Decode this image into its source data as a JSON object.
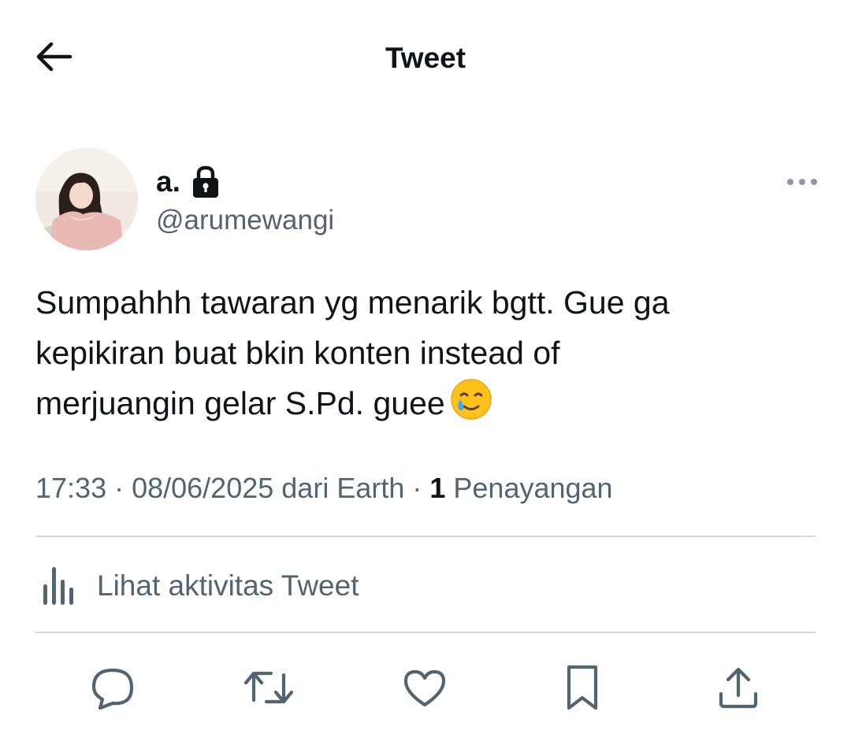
{
  "header": {
    "back_icon": "arrow-left-icon",
    "title": "Tweet"
  },
  "author": {
    "display_name": "a.",
    "handle": "@arumewangi",
    "protected_icon": "lock-icon"
  },
  "tweet": {
    "lines": [
      "Sumpahhh tawaran yg menarik bgtt. Gue ga",
      "kepikiran buat bkin konten instead of",
      "merjuangin gelar S.Pd. guee"
    ],
    "emoji": "smiling-face-with-tear"
  },
  "meta": {
    "time": "17:33",
    "sep1": " · ",
    "date": "08/06/2025",
    "source": " dari Earth",
    "sep2": " · ",
    "views_count": "1",
    "views_label": " Penayangan"
  },
  "activity": {
    "label": "Lihat aktivitas Tweet",
    "icon": "analytics-bars-icon"
  },
  "actions": [
    "reply-icon",
    "retweet-icon",
    "like-icon",
    "bookmark-icon",
    "share-icon"
  ],
  "colors": {
    "text_primary": "#0f1419",
    "text_secondary": "#536471",
    "divider": "#cfd9de"
  }
}
